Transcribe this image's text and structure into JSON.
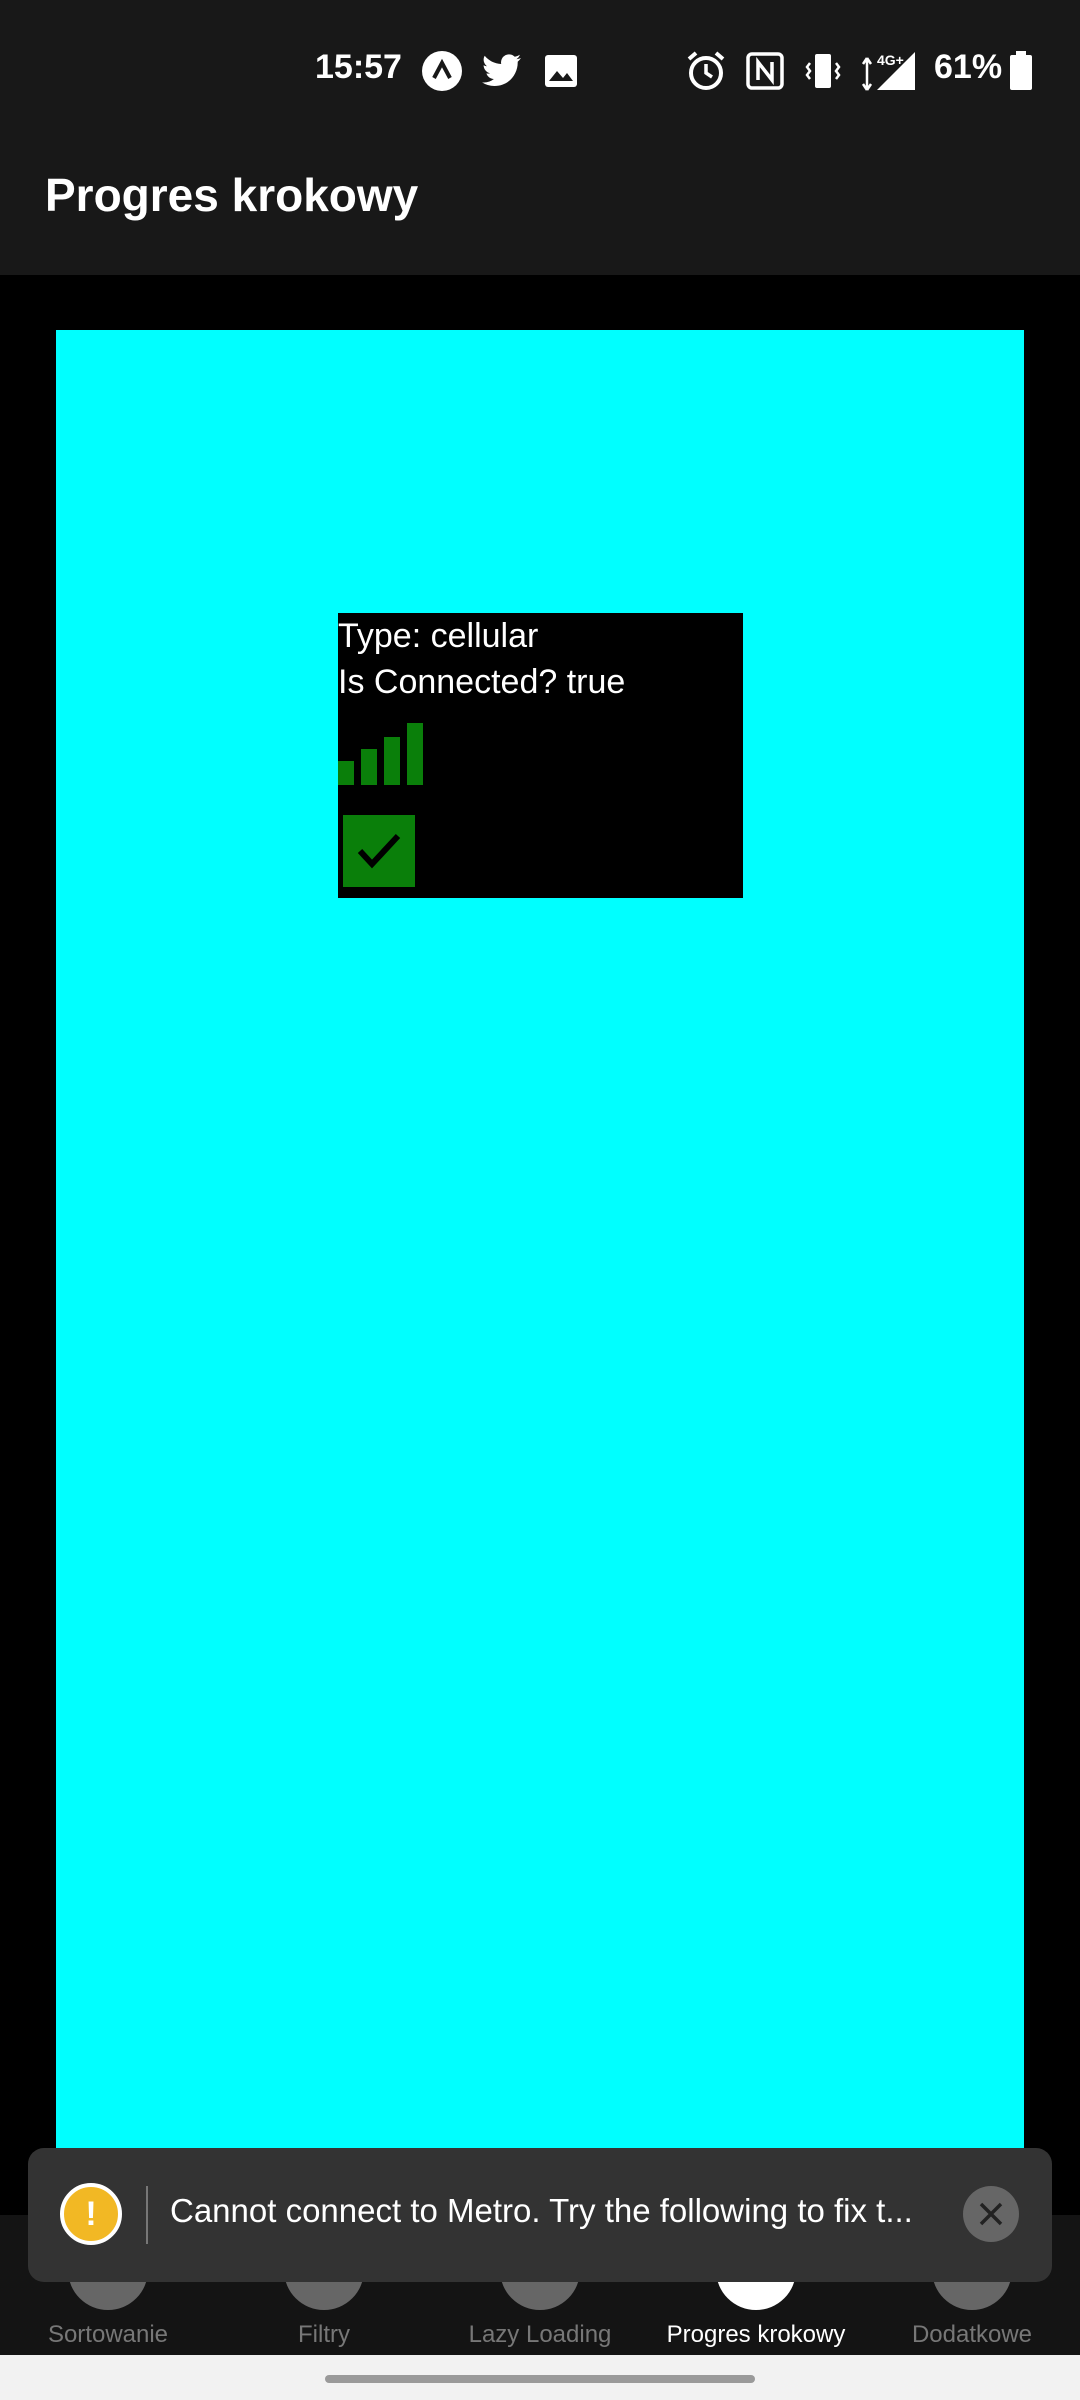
{
  "status_bar": {
    "time": "15:57",
    "network_label": "4G+",
    "battery": "61%",
    "icons": [
      "expo-icon",
      "twitter-icon",
      "image-icon",
      "alarm-icon",
      "nfc-icon",
      "vibrate-icon",
      "signal-icon",
      "battery-icon"
    ]
  },
  "header": {
    "title": "Progres krokowy"
  },
  "network_info": {
    "type_line": "Type: cellular",
    "connected_line": "Is Connected? true",
    "colors": {
      "panel": "#00ffff",
      "box": "#000000",
      "indicator": "#0a7f0a"
    }
  },
  "tabs": [
    {
      "label": "Sortowanie",
      "active": false
    },
    {
      "label": "Filtry",
      "active": false
    },
    {
      "label": "Lazy Loading",
      "active": false
    },
    {
      "label": "Progres krokowy",
      "active": true
    },
    {
      "label": "Dodatkowe",
      "active": false
    }
  ],
  "toast": {
    "message": "Cannot connect to Metro.  Try the following to fix t..."
  }
}
